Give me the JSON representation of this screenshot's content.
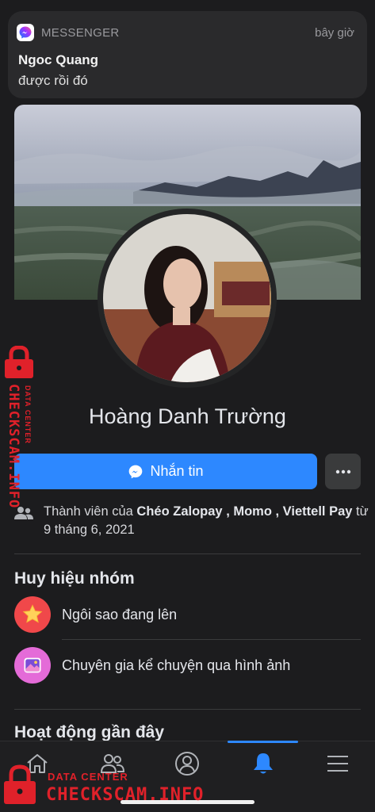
{
  "notification": {
    "app_name": "MESSENGER",
    "time": "bây giờ",
    "sender": "Ngoc Quang",
    "message": "được rồi đó",
    "icon": "messenger-icon"
  },
  "profile": {
    "name": "Hoàng Danh Trường",
    "message_button": "Nhắn tin",
    "more_button_icon": "more-dots-icon"
  },
  "membership": {
    "prefix": "Thành viên của ",
    "groups": "Chéo Zalopay , Momo , Viettell Pay",
    "suffix": " từ 9 tháng 6, 2021",
    "icon": "people-icon"
  },
  "badges": {
    "title": "Huy hiệu nhóm",
    "items": [
      {
        "label": "Ngôi sao đang lên",
        "icon": "rising-star-icon",
        "color": "#f0484a"
      },
      {
        "label": "Chuyên gia kể chuyện qua hình ảnh",
        "icon": "visual-storyteller-icon",
        "color": "#e46bd8"
      }
    ]
  },
  "recent_activity": {
    "title": "Hoạt động gần đây"
  },
  "bottom_nav": {
    "items": [
      {
        "name": "home",
        "icon": "home-icon"
      },
      {
        "name": "groups",
        "icon": "friends-icon"
      },
      {
        "name": "profile",
        "icon": "profile-icon"
      },
      {
        "name": "notifications",
        "icon": "bell-icon",
        "active": true
      },
      {
        "name": "menu",
        "icon": "menu-icon"
      }
    ]
  },
  "watermark": {
    "small": "DATA CENTER",
    "large": "CHECKSCAM.INFO",
    "color": "#e0212a"
  },
  "colors": {
    "accent": "#2d88ff",
    "background": "#1c1c1e"
  }
}
